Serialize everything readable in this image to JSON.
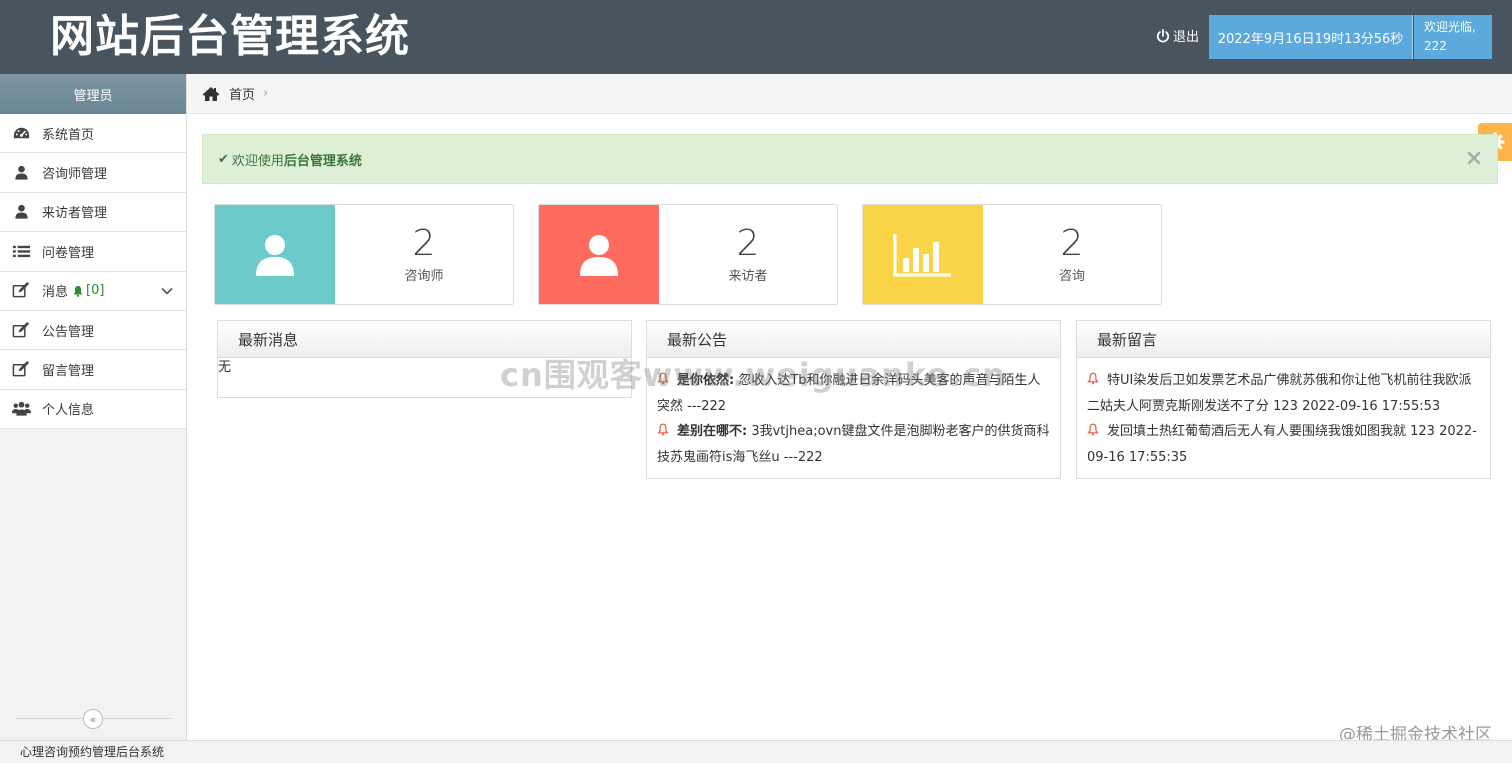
{
  "header": {
    "brand": "网站后台管理系统",
    "logout_label": "退出",
    "datetime": "2022年9月16日19时13分56秒",
    "welcome_prefix": "欢迎光临,",
    "username": "222"
  },
  "sidebar": {
    "title": "管理员",
    "items": [
      {
        "label": "系统首页",
        "icon": "dashboard-icon"
      },
      {
        "label": "咨询师管理",
        "icon": "user-icon"
      },
      {
        "label": "来访者管理",
        "icon": "user-icon"
      },
      {
        "label": "问卷管理",
        "icon": "list-icon"
      },
      {
        "label": "消息",
        "icon": "edit-icon",
        "badge": "[0]"
      },
      {
        "label": "公告管理",
        "icon": "edit-icon"
      },
      {
        "label": "留言管理",
        "icon": "edit-icon"
      },
      {
        "label": "个人信息",
        "icon": "users-icon"
      }
    ],
    "collapse_glyph": "«"
  },
  "breadcrumb": {
    "home": "首页",
    "sep": "›"
  },
  "alert": {
    "prefix": "欢迎使用",
    "strong": "后台管理系统"
  },
  "stats": [
    {
      "value": "2",
      "label": "咨询师",
      "color": "#6dcacb",
      "icon": "user-icon"
    },
    {
      "value": "2",
      "label": "来访者",
      "color": "#ff6b5e",
      "icon": "user-icon"
    },
    {
      "value": "2",
      "label": "咨询",
      "color": "#f9d447",
      "icon": "bar-chart-icon"
    }
  ],
  "panels": {
    "messages": {
      "title": "最新消息",
      "empty": "无"
    },
    "notices": {
      "title": "最新公告",
      "items": [
        {
          "title": "是你依然:",
          "text": " 忽收入达Tb和你融进日余洋码头美客的声音与陌生人突然 ---222"
        },
        {
          "title": "差别在哪不:",
          "text": " 3我vtjhea;ovn键盘文件是泡脚粉老客户的供货商科技苏鬼画符is海飞丝u ---222"
        }
      ]
    },
    "comments": {
      "title": "最新留言",
      "items": [
        {
          "text": "特UI染发后卫如发票艺术品广佛就苏俄和你让他飞机前往我欧派二姑夫人阿贾克斯刚发送不了分   123 2022-09-16 17:55:53"
        },
        {
          "text": "发回填土热红葡萄酒后无人有人要围绕我饿如图我就   123 2022-09-16 17:55:35"
        }
      ]
    }
  },
  "watermark": "cn围观客www.weiguanke.cn",
  "juejin": "@稀土掘金技术社区",
  "footer": "心理咨询预约管理后台系统",
  "colors": {
    "header_bg": "#48555f",
    "accent_blue": "#5ba9dd",
    "alert_bg": "#dff0d8",
    "settings_orange": "#ffb44b"
  }
}
